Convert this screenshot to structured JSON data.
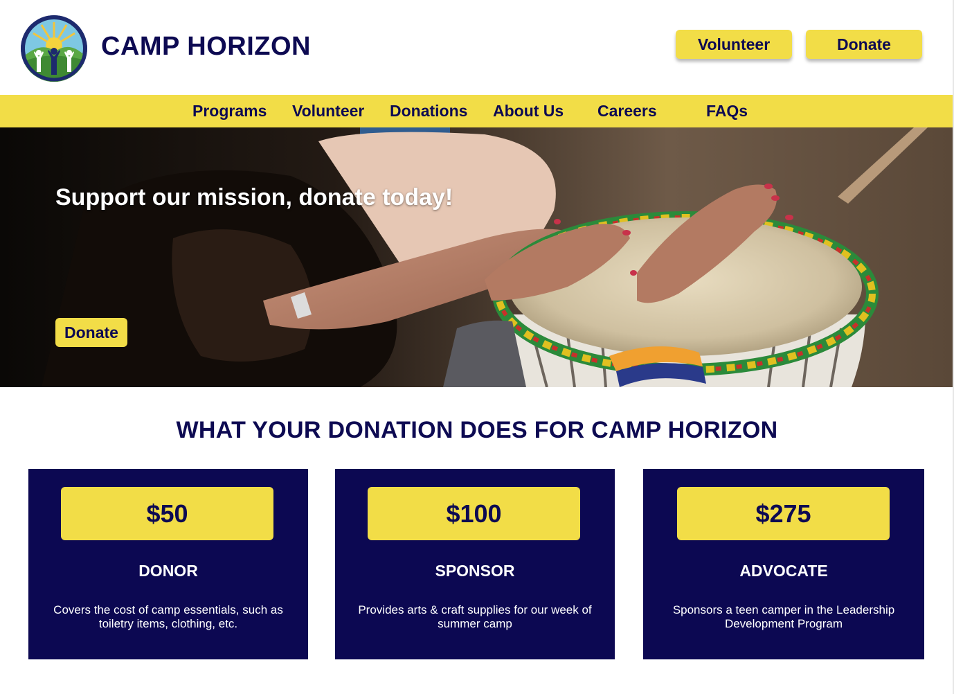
{
  "header": {
    "brand": "CAMP HORIZON",
    "volunteer_label": "Volunteer",
    "donate_label": "Donate"
  },
  "nav": {
    "items": [
      {
        "label": "Programs"
      },
      {
        "label": "Volunteer"
      },
      {
        "label": "Donations"
      },
      {
        "label": "About Us"
      },
      {
        "label": "Careers"
      },
      {
        "label": "FAQs"
      }
    ]
  },
  "hero": {
    "title": "Support our mission, donate today!",
    "donate_label": "Donate"
  },
  "donations": {
    "title": "WHAT YOUR DONATION DOES FOR CAMP HORIZON",
    "tiers": [
      {
        "amount": "$50",
        "name": "DONOR",
        "description": "Covers the cost of camp essentials, such as toiletry items, clothing, etc."
      },
      {
        "amount": "$100",
        "name": "SPONSOR",
        "description": "Provides arts & craft supplies for our week of summer camp"
      },
      {
        "amount": "$275",
        "name": "ADVOCATE",
        "description": "Sponsors a teen camper in the Leadership Development Program"
      }
    ]
  },
  "colors": {
    "accent_yellow": "#f2dd47",
    "navy": "#0c0852",
    "white": "#ffffff"
  },
  "icons": {
    "logo": "camp-logo-icon"
  }
}
